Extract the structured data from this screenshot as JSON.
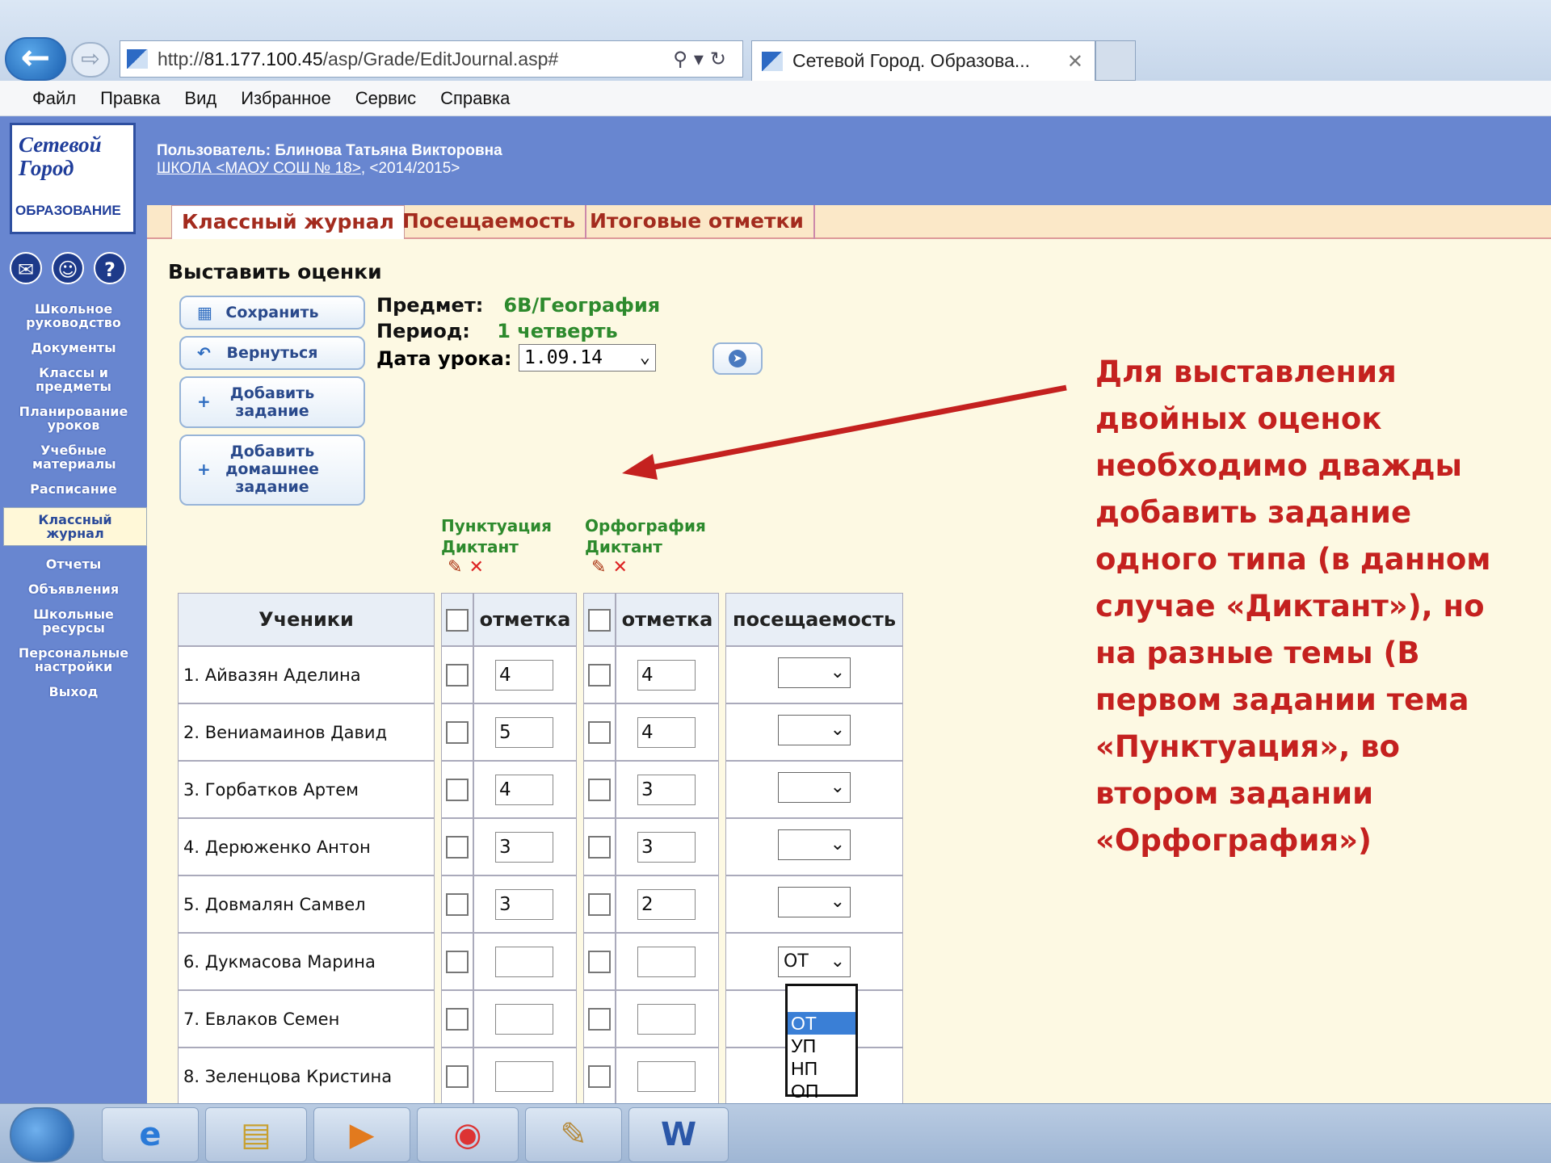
{
  "browser": {
    "url_prefix": "http://",
    "url_host": "81.177.100.45",
    "url_path": "/asp/Grade/EditJournal.asp#",
    "tab_title": "Сетевой Город. Образова...",
    "menu": [
      "Файл",
      "Правка",
      "Вид",
      "Избранное",
      "Сервис",
      "Справка"
    ]
  },
  "logo": {
    "line1": "Сетевой",
    "line2": "Город",
    "line3": "ОБРАЗОВАНИЕ"
  },
  "header": {
    "user": "Пользователь: Блинова Татьяна Викторовна",
    "school": "ШКОЛА <МАОУ СОШ № 18>",
    "year": ", <2014/2015>"
  },
  "tabs": [
    "Классный журнал",
    "Посещаемость",
    "Итоговые отметки"
  ],
  "nav": [
    "Школьное руководство",
    "Документы",
    "Классы и предметы",
    "Планирование уроков",
    "Учебные материалы",
    "Расписание",
    "Классный журнал",
    "Отчеты",
    "Объявления",
    "Школьные ресурсы",
    "Персональные настройки",
    "Выход"
  ],
  "page_title": "Выставить оценки",
  "actions": {
    "save": "Сохранить",
    "back": "Вернуться",
    "add_task": "Добавить задание",
    "add_homework": "Добавить домашнее задание"
  },
  "info": {
    "subject_label": "Предмет:",
    "subject_value": "6В/География",
    "period_label": "Период:",
    "period_value": "1 четверть",
    "date_label": "Дата урока:",
    "date_value": "1.09.14"
  },
  "assignments": [
    {
      "topic": "Пунктуация",
      "type": "Диктант"
    },
    {
      "topic": "Орфография",
      "type": "Диктант"
    }
  ],
  "table": {
    "headers": {
      "students": "Ученики",
      "mark": "отметка",
      "attendance": "посещаемость"
    },
    "rows": [
      {
        "name": "1. Айвазян Аделина",
        "m1": "4",
        "m2": "4",
        "att": ""
      },
      {
        "name": "2. Вениамаинов Давид",
        "m1": "5",
        "m2": "4",
        "att": ""
      },
      {
        "name": "3. Горбатков Артем",
        "m1": "4",
        "m2": "3",
        "att": ""
      },
      {
        "name": "4. Дерюженко Антон",
        "m1": "3",
        "m2": "3",
        "att": ""
      },
      {
        "name": "5. Довмалян Самвел",
        "m1": "3",
        "m2": "2",
        "att": ""
      },
      {
        "name": "6. Дукмасова Марина",
        "m1": "",
        "m2": "",
        "att": "ОТ"
      },
      {
        "name": "7. Евлаков Семен",
        "m1": "",
        "m2": "",
        "att": ""
      },
      {
        "name": "8. Зеленцова Кристина",
        "m1": "",
        "m2": "",
        "att": ""
      }
    ]
  },
  "attendance_options": [
    "ОТ",
    "УП",
    "НП",
    "ОП"
  ],
  "annotation": "Для выставления двойных оценок необходимо дважды добавить задание одного типа (в данном случае «Диктант»), но на разные темы (В первом задании тема «Пунктуация», во втором задании «Орфография»)",
  "colors": {
    "nav_bg": "#6886d0",
    "page_bg": "#fdf9e3",
    "accent_red": "#c4211f",
    "subject_green": "#2d8a2d"
  }
}
